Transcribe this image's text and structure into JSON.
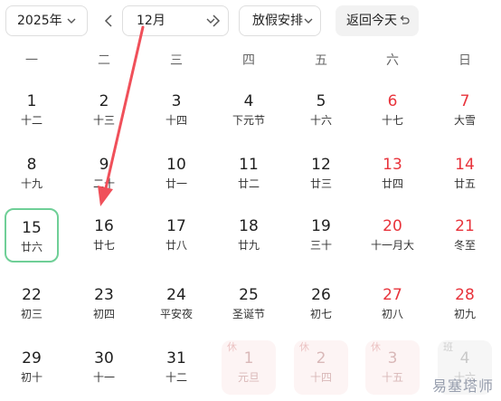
{
  "toolbar": {
    "year_label": "2025年",
    "month_label": "12月",
    "holiday_label": "放假安排",
    "today_label": "返回今天"
  },
  "weekdays": [
    "一",
    "二",
    "三",
    "四",
    "五",
    "六",
    "日"
  ],
  "weeks": [
    [
      {
        "day": "1",
        "lunar": "十二"
      },
      {
        "day": "2",
        "lunar": "十三"
      },
      {
        "day": "3",
        "lunar": "十四"
      },
      {
        "day": "4",
        "lunar": "下元节"
      },
      {
        "day": "5",
        "lunar": "十六"
      },
      {
        "day": "6",
        "lunar": "十七",
        "weekend": true
      },
      {
        "day": "7",
        "lunar": "大雪",
        "weekend": true
      }
    ],
    [
      {
        "day": "8",
        "lunar": "十九"
      },
      {
        "day": "9",
        "lunar": "二十"
      },
      {
        "day": "10",
        "lunar": "廿一"
      },
      {
        "day": "11",
        "lunar": "廿二"
      },
      {
        "day": "12",
        "lunar": "廿三"
      },
      {
        "day": "13",
        "lunar": "廿四",
        "weekend": true
      },
      {
        "day": "14",
        "lunar": "廿五",
        "weekend": true
      }
    ],
    [
      {
        "day": "15",
        "lunar": "廿六",
        "selected": true
      },
      {
        "day": "16",
        "lunar": "廿七"
      },
      {
        "day": "17",
        "lunar": "廿八"
      },
      {
        "day": "18",
        "lunar": "廿九"
      },
      {
        "day": "19",
        "lunar": "三十"
      },
      {
        "day": "20",
        "lunar": "十一月大",
        "weekend": true
      },
      {
        "day": "21",
        "lunar": "冬至",
        "weekend": true
      }
    ],
    [
      {
        "day": "22",
        "lunar": "初三"
      },
      {
        "day": "23",
        "lunar": "初四"
      },
      {
        "day": "24",
        "lunar": "平安夜"
      },
      {
        "day": "25",
        "lunar": "圣诞节"
      },
      {
        "day": "26",
        "lunar": "初七"
      },
      {
        "day": "27",
        "lunar": "初八",
        "weekend": true
      },
      {
        "day": "28",
        "lunar": "初九",
        "weekend": true
      }
    ],
    [
      {
        "day": "29",
        "lunar": "初十"
      },
      {
        "day": "30",
        "lunar": "十一"
      },
      {
        "day": "31",
        "lunar": "十二"
      },
      {
        "day": "1",
        "lunar": "元旦",
        "other_month": true,
        "tag": "休"
      },
      {
        "day": "2",
        "lunar": "十四",
        "other_month": true,
        "tag": "休"
      },
      {
        "day": "3",
        "lunar": "十五",
        "other_month": true,
        "tag": "休"
      },
      {
        "day": "4",
        "lunar": "十六",
        "other_month": true,
        "tag": "班",
        "work": true
      }
    ]
  ],
  "watermark": "易塞塔师"
}
